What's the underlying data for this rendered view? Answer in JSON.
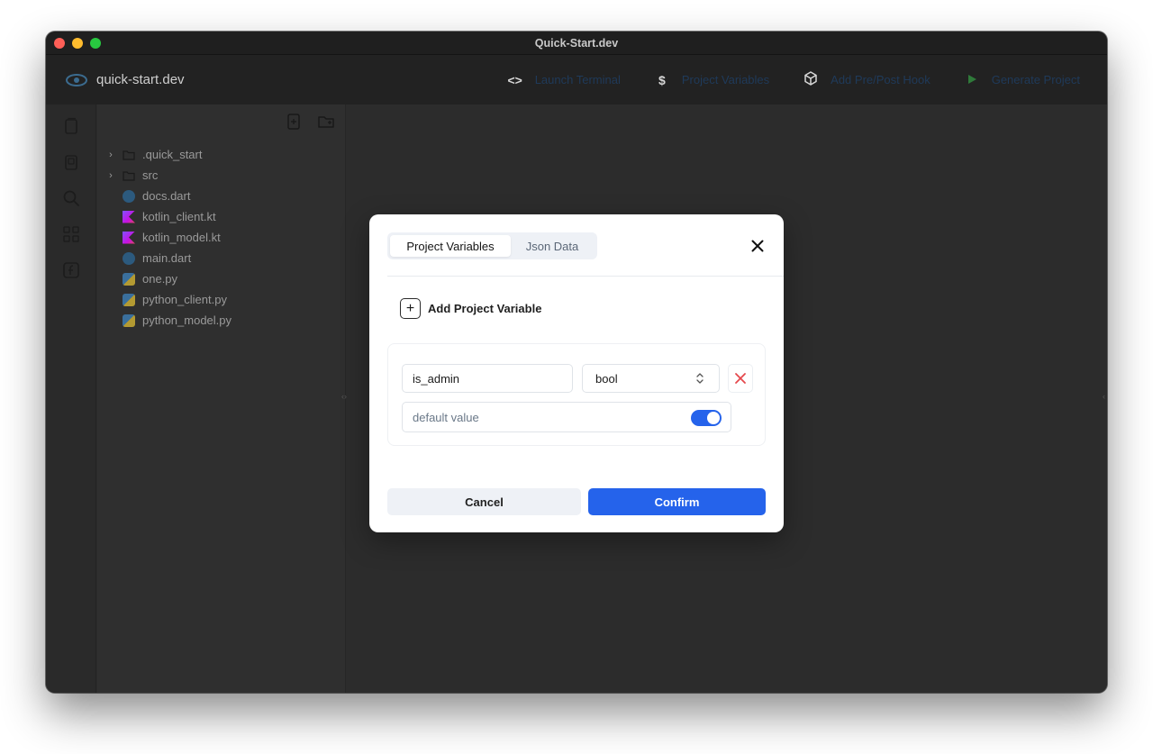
{
  "window": {
    "title": "Quick-Start.dev"
  },
  "appbar": {
    "brand_name": "quick-start.dev",
    "actions": [
      {
        "icon": "code-brackets-icon",
        "label": "Launch Terminal"
      },
      {
        "icon": "dollar-icon",
        "label": "Project Variables"
      },
      {
        "icon": "cube-icon",
        "label": "Add Pre/Post Hook"
      },
      {
        "icon": "play-icon",
        "label": "Generate Project"
      }
    ]
  },
  "activity_bar": {
    "items": [
      "files-icon",
      "documents-icon",
      "search-icon",
      "grid-icon",
      "function-icon"
    ]
  },
  "explorer": {
    "items": [
      {
        "name": ".quick_start",
        "type": "folder"
      },
      {
        "name": "src",
        "type": "folder"
      },
      {
        "name": "docs.dart",
        "type": "dart"
      },
      {
        "name": "kotlin_client.kt",
        "type": "kotlin"
      },
      {
        "name": "kotlin_model.kt",
        "type": "kotlin"
      },
      {
        "name": "main.dart",
        "type": "dart"
      },
      {
        "name": "one.py",
        "type": "python"
      },
      {
        "name": "python_client.py",
        "type": "python"
      },
      {
        "name": "python_model.py",
        "type": "python"
      }
    ]
  },
  "modal": {
    "tabs": [
      {
        "label": "Project Variables",
        "active": true
      },
      {
        "label": "Json Data",
        "active": false
      }
    ],
    "add_variable_label": "Add Project Variable",
    "variable": {
      "name": "is_admin",
      "type": "bool",
      "default_label": "default value",
      "default_value": true
    },
    "cancel_label": "Cancel",
    "confirm_label": "Confirm"
  },
  "colors": {
    "accent": "#2563eb",
    "delete": "#e5484d"
  }
}
